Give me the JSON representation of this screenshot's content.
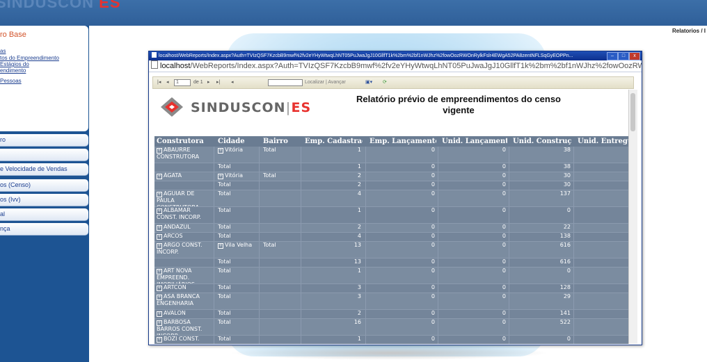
{
  "app": {
    "logo_text": "SINDUSCON",
    "logo_es": "ES"
  },
  "breadcrumb": "Relatorios / I",
  "sidebar": {
    "title": "ro Base",
    "subitems": [
      "as",
      "tos do Empreendimento",
      "Estágios do",
      "endimento",
      "Pessoas"
    ],
    "items": [
      "ro",
      "",
      "e Velocidade de Vendas",
      "os (Censo)",
      "os (Ivv)",
      "al",
      "nça"
    ]
  },
  "popup": {
    "title": "localhost/WebReports/Index.aspx?Auth=TVIzQSF7KzcbB9mwf%2fv2eYHyWtwqLhNT05PuJwaJgJ10GllfT1k%2bm%2bf1nWJhz%2fowOozRWOnRylkFslr4EWgA52PA8zentNFLSqGyEOPPn...",
    "address_host": "localhost",
    "address_rest": "/WebReports/Index.aspx?Auth=TVIzQSF7KzcbB9mwf%2fv2eYHyWtwqLhNT05PuJwaJgJ10GllfT1k%2bm%2bf1nWJhz%2fowOozRWOnRylkFslr4E",
    "toolbar": {
      "page_value": "1",
      "page_of": "de 1",
      "find_label": "Localizar | Avançar"
    }
  },
  "report": {
    "brand": "SINDUSCON",
    "brand_es": "ES",
    "title": "Relatório prévio de empreendimentos do censo vigente",
    "columns": [
      "Construtora",
      "Cidade",
      "Bairro",
      "Emp. Cadastrados",
      "Emp. Lançamentos",
      "Unid. Lançamentos",
      "Unid. Construção",
      "Unid. Entregues"
    ],
    "rows": [
      {
        "constr": "ABAURRE CONSTRUTORA",
        "cons_pm": true,
        "cidade": "Vitória",
        "cid_pm": true,
        "bairro": "Total",
        "emp_cad": "1",
        "emp_lanc": "0",
        "unid_lanc": "0",
        "unid_const": "38"
      },
      {
        "constr": "",
        "cons_pm": false,
        "cidade": "Total",
        "cid_pm": false,
        "bairro": "",
        "emp_cad": "1",
        "emp_lanc": "0",
        "unid_lanc": "0",
        "unid_const": "38"
      },
      {
        "constr": "ÁGATA",
        "cons_pm": true,
        "cidade": "Vitória",
        "cid_pm": true,
        "bairro": "Total",
        "emp_cad": "2",
        "emp_lanc": "0",
        "unid_lanc": "0",
        "unid_const": "30"
      },
      {
        "constr": "",
        "cons_pm": false,
        "cidade": "Total",
        "cid_pm": false,
        "bairro": "",
        "emp_cad": "2",
        "emp_lanc": "0",
        "unid_lanc": "0",
        "unid_const": "30"
      },
      {
        "constr": "AGUIAR DE PAULA CONSTRUTORA",
        "cons_pm": true,
        "cidade": "Total",
        "cid_pm": false,
        "bairro": "",
        "emp_cad": "4",
        "emp_lanc": "0",
        "unid_lanc": "0",
        "unid_const": "137"
      },
      {
        "constr": "ALBAMAR CONST. INCORP.",
        "cons_pm": true,
        "cidade": "Total",
        "cid_pm": false,
        "bairro": "",
        "emp_cad": "1",
        "emp_lanc": "0",
        "unid_lanc": "0",
        "unid_const": "0"
      },
      {
        "constr": "ANDAZUL",
        "cons_pm": true,
        "cidade": "Total",
        "cid_pm": false,
        "bairro": "",
        "emp_cad": "2",
        "emp_lanc": "0",
        "unid_lanc": "0",
        "unid_const": "22"
      },
      {
        "constr": "ARCOS",
        "cons_pm": true,
        "cidade": "Total",
        "cid_pm": false,
        "bairro": "",
        "emp_cad": "4",
        "emp_lanc": "0",
        "unid_lanc": "0",
        "unid_const": "138"
      },
      {
        "constr": "ARGO CONST. INCORP.",
        "cons_pm": true,
        "cidade": "Vila Velha",
        "cid_pm": true,
        "bairro": "Total",
        "emp_cad": "13",
        "emp_lanc": "0",
        "unid_lanc": "0",
        "unid_const": "616"
      },
      {
        "constr": "",
        "cons_pm": false,
        "cidade": "Total",
        "cid_pm": false,
        "bairro": "",
        "emp_cad": "13",
        "emp_lanc": "0",
        "unid_lanc": "0",
        "unid_const": "616"
      },
      {
        "constr": "ART NOVA EMPREEND. IMOBILIÁRIOS",
        "cons_pm": true,
        "cidade": "Total",
        "cid_pm": false,
        "bairro": "",
        "emp_cad": "1",
        "emp_lanc": "0",
        "unid_lanc": "0",
        "unid_const": "0"
      },
      {
        "constr": "ARTCON",
        "cons_pm": true,
        "cidade": "Total",
        "cid_pm": false,
        "bairro": "",
        "emp_cad": "3",
        "emp_lanc": "0",
        "unid_lanc": "0",
        "unid_const": "128"
      },
      {
        "constr": "ASA BRANCA ENGENHARIA",
        "cons_pm": true,
        "cidade": "Total",
        "cid_pm": false,
        "bairro": "",
        "emp_cad": "3",
        "emp_lanc": "0",
        "unid_lanc": "0",
        "unid_const": "29"
      },
      {
        "constr": "AVALON",
        "cons_pm": true,
        "cidade": "Total",
        "cid_pm": false,
        "bairro": "",
        "emp_cad": "2",
        "emp_lanc": "0",
        "unid_lanc": "0",
        "unid_const": "141"
      },
      {
        "constr": "BARBOSA BARROS CONST. INCORP.",
        "cons_pm": true,
        "cidade": "Total",
        "cid_pm": false,
        "bairro": "",
        "emp_cad": "16",
        "emp_lanc": "0",
        "unid_lanc": "0",
        "unid_const": "522"
      },
      {
        "constr": "BOZI CONST.",
        "cons_pm": true,
        "cidade": "Total",
        "cid_pm": false,
        "bairro": "",
        "emp_cad": "1",
        "emp_lanc": "0",
        "unid_lanc": "0",
        "unid_const": "0"
      }
    ]
  }
}
